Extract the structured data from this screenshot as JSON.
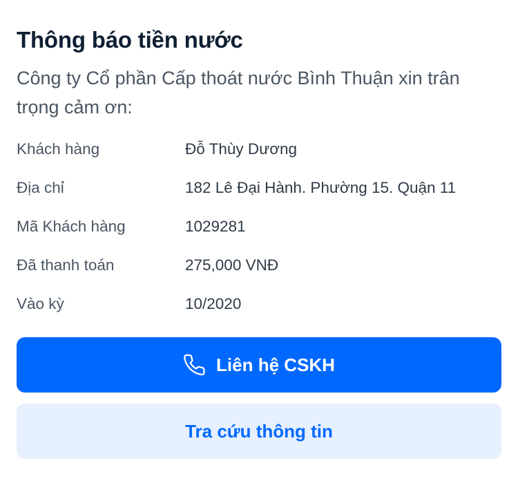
{
  "card": {
    "title": "Thông báo tiền nước",
    "intro": "Công ty Cổ phần Cấp thoát nước Bình Thuận xin trân trọng cảm ơn:"
  },
  "info": [
    {
      "label": "Khách hàng",
      "value": "Đỗ Thùy Dương"
    },
    {
      "label": "Địa chỉ",
      "value": "182 Lê Đại Hành. Phường 15. Quận 11"
    },
    {
      "label": "Mã Khách hàng",
      "value": "1029281"
    },
    {
      "label": "Đã thanh toán",
      "value": "275,000 VNĐ"
    },
    {
      "label": "Vào kỳ",
      "value": "10/2020"
    }
  ],
  "actions": {
    "contact_label": "Liên hệ CSKH",
    "contact_icon": "phone-icon",
    "lookup_label": "Tra cứu thông tin"
  },
  "colors": {
    "primary": "#0068ff",
    "secondary_bg": "#e6f0ff",
    "title": "#0f1f33",
    "text_muted": "#4a5563"
  }
}
